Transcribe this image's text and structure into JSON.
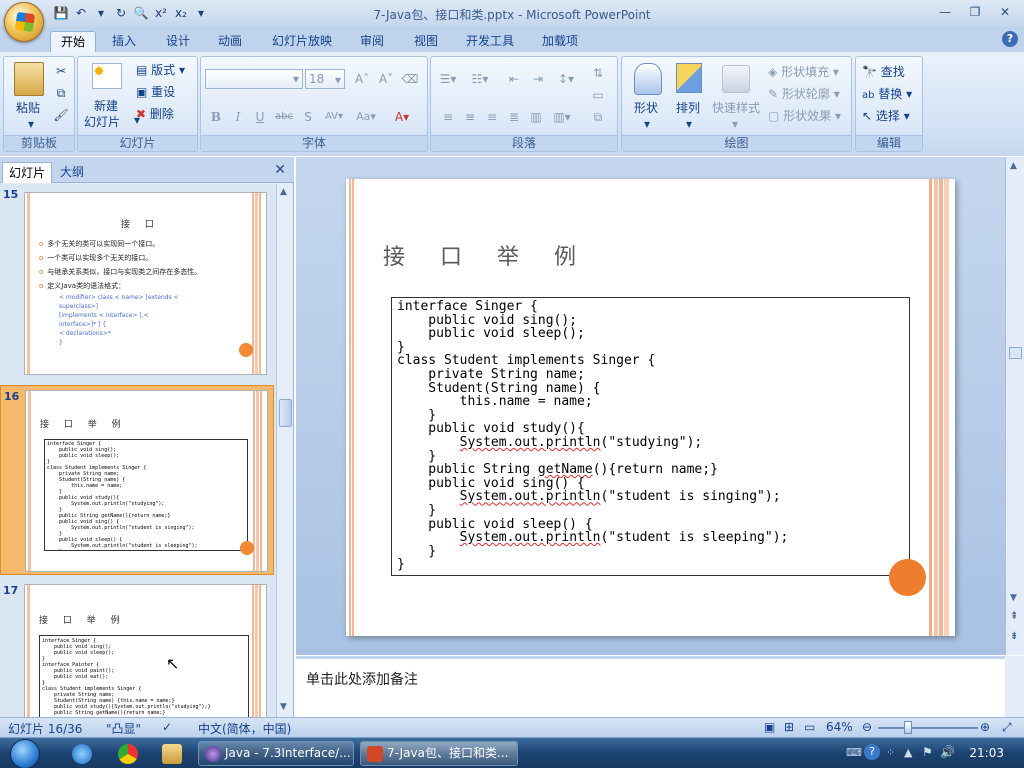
{
  "window": {
    "title": "7-Java包、接口和类.pptx - Microsoft PowerPoint"
  },
  "ribbon_tabs": [
    "开始",
    "插入",
    "设计",
    "动画",
    "幻灯片放映",
    "审阅",
    "视图",
    "开发工具",
    "加载项"
  ],
  "ribbon": {
    "clipboard": {
      "group": "剪贴板",
      "paste": "粘贴"
    },
    "slides": {
      "group": "幻灯片",
      "new_slide_1": "新建",
      "new_slide_2": "幻灯片",
      "layout": "版式",
      "reset": "重设",
      "delete": "删除"
    },
    "font": {
      "group": "字体",
      "font_name": "",
      "font_size": "18"
    },
    "paragraph": {
      "group": "段落"
    },
    "drawing": {
      "group": "绘图",
      "shapes": "形状",
      "arrange": "排列",
      "quick_styles": "快速样式",
      "shape_fill": "形状填充",
      "shape_outline": "形状轮廓",
      "shape_effects": "形状效果"
    },
    "editing": {
      "group": "编辑",
      "find": "查找",
      "replace": "替换",
      "select": "选择"
    }
  },
  "pane": {
    "tab_slides": "幻灯片",
    "tab_outline": "大纲"
  },
  "thumbs": {
    "s15": {
      "num": "15",
      "title": "接 口",
      "bullets": [
        "多个无关的类可以实现同一个接口。",
        "一个类可以实现多个无关的接口。",
        "与继承关系类似，接口与实现类之间存在多态性。",
        "定义Java类的语法格式："
      ],
      "syntax": [
        "< modifier> class < name> [extends <",
        "superclass>]",
        "[implements < interface> [,<",
        "interface>]* ] {",
        "  < declarations>*",
        "}"
      ]
    },
    "s16": {
      "num": "16",
      "title": "接 口 举 例",
      "code": "interface Singer {\n    public void sing();\n    public void sleep();\n}\nclass Student implements Singer {\n    private String name;\n    Student(String name) {\n        this.name = name;\n    }\n    public void study(){\n        System.out.println(\"studying\");\n    }\n    public String getName(){return name;}\n    public void sing() {\n        System.out.println(\"student is singing\");\n    }\n    public void sleep() {\n        System.out.println(\"student is sleeping\");\n    }\n}"
    },
    "s17": {
      "num": "17",
      "title": "接 口 举 例",
      "code": "interface Singer {\n    public void sing();\n    public void sleep();\n}\ninterface Painter {\n    public void paint();\n    public void eat();\n}\nclass Student implements Singer {\n    private String name;\n    Student(String name) {this.name = name;}\n    public void study(){System.out.println(\"studying\");}\n    public String getName(){return name;}"
    }
  },
  "slide": {
    "title": "接 口 举 例",
    "code_lines": [
      {
        "a": "interface Singer {"
      },
      {
        "a": "    public void sing();"
      },
      {
        "a": "    public void sleep();"
      },
      {
        "a": "}"
      },
      {
        "a": "class Student implements Singer {"
      },
      {
        "a": "    private String name;"
      },
      {
        "a": "    Student(String name) {"
      },
      {
        "a": "        this.name = name;"
      },
      {
        "a": "    }"
      },
      {
        "a": "    public void study(){"
      },
      {
        "a": "        ",
        "u": "System.out.println",
        "b": "(\"studying\");"
      },
      {
        "a": "    }"
      },
      {
        "a": "    public String ",
        "u": "getName",
        "b": "(){return name;}"
      },
      {
        "a": "    public void sing() {"
      },
      {
        "a": "        ",
        "u": "System.out.println",
        "b": "(\"student is singing\");"
      },
      {
        "a": "    }"
      },
      {
        "a": "    public void sleep() {"
      },
      {
        "a": "        ",
        "u": "System.out.println",
        "b": "(\"student is sleeping\");"
      },
      {
        "a": "    }"
      },
      {
        "a": "}"
      }
    ]
  },
  "notes": {
    "placeholder": "单击此处添加备注"
  },
  "status": {
    "slide_counter": "幻灯片 16/36",
    "theme": "\"凸显\"",
    "language": "中文(简体，中国)",
    "zoom": "64%"
  },
  "taskbar": {
    "item1": "Java - 7.3Interface/...",
    "item2": "7-Java包、接口和类...",
    "clock": "21:03"
  }
}
